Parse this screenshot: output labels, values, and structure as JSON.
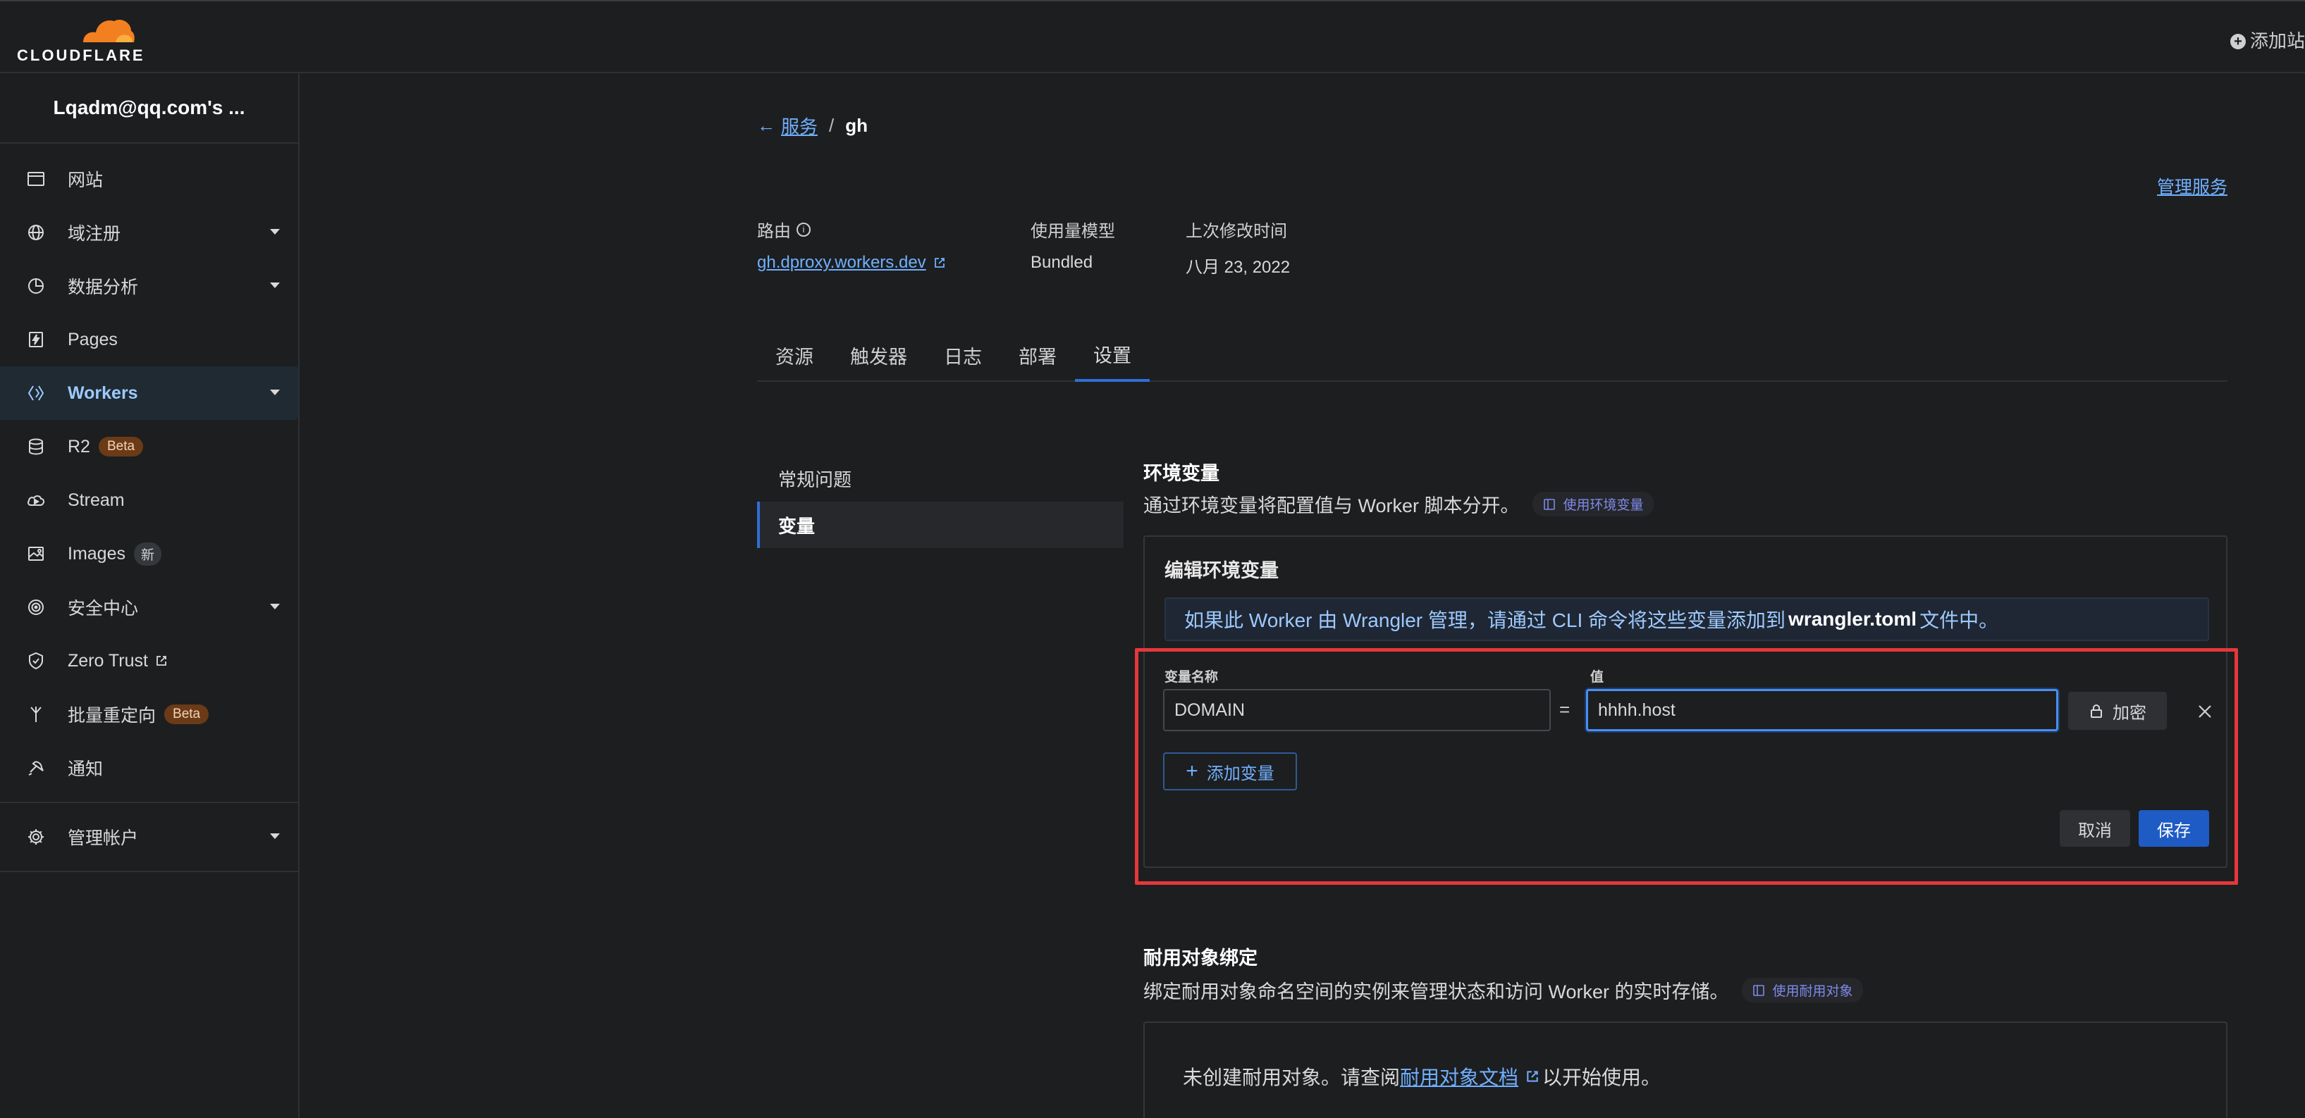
{
  "brand": {
    "name": "CLOUDFLARE",
    "orange": "#f38020"
  },
  "header": {
    "add_site_label": "添加站"
  },
  "sidebar": {
    "account": "Lqadm@qq.com's ...",
    "items": [
      {
        "label": "网站",
        "icon": "browser-window-icon"
      },
      {
        "label": "域注册",
        "icon": "globe-icon"
      },
      {
        "label": "数据分析",
        "icon": "pie-chart-icon"
      },
      {
        "label": "Pages",
        "icon": "lightning-page-icon"
      },
      {
        "label": "Workers",
        "icon": "workers-diamond-icon"
      },
      {
        "label": "R2",
        "icon": "database-icon",
        "badge": "Beta"
      },
      {
        "label": "Stream",
        "icon": "cloud-stream-icon"
      },
      {
        "label": "Images",
        "icon": "image-icon",
        "badge": "新"
      },
      {
        "label": "安全中心",
        "icon": "security-target-icon"
      },
      {
        "label": "Zero Trust",
        "icon": "shield-icon"
      },
      {
        "label": "批量重定向",
        "icon": "redirect-fork-icon",
        "badge": "Beta"
      },
      {
        "label": "通知",
        "icon": "notification-icon"
      },
      {
        "label": "管理帐户",
        "icon": "gear-icon"
      }
    ]
  },
  "breadcrumb": {
    "parent": "服务",
    "separator": "/",
    "current": "gh"
  },
  "manage_service": "管理服务",
  "meta": {
    "route_label": "路由",
    "route_value": "gh.dproxy.workers.dev",
    "usage_label": "使用量模型",
    "usage_value": "Bundled",
    "modified_label": "上次修改时间",
    "modified_value": "八月 23, 2022"
  },
  "tabs": [
    "资源",
    "触发器",
    "日志",
    "部署",
    "设置"
  ],
  "active_tab": "设置",
  "subnav": [
    "常规问题",
    "变量"
  ],
  "env": {
    "title": "环境变量",
    "desc": "通过环境变量将配置值与 Worker 脚本分开。",
    "doc_link": "使用环境变量",
    "edit_title": "编辑环境变量",
    "notice_pre": "如果此 Worker 由 Wrangler 管理，请通过 CLI 命令将这些变量添加到",
    "notice_file": "wrangler.toml",
    "notice_post": "文件中。",
    "name_label": "变量名称",
    "value_label": "值",
    "name_value": "DOMAIN",
    "value_value": "hhhh.host",
    "equals": "=",
    "encrypt_label": "加密",
    "add_var_label": "添加变量",
    "cancel_label": "取消",
    "save_label": "保存"
  },
  "durable": {
    "title": "耐用对象绑定",
    "desc": "绑定耐用对象命名空间的实例来管理状态和访问 Worker 的实时存储。",
    "doc_link": "使用耐用对象",
    "empty_pre": "未创建耐用对象。请查阅",
    "empty_link": "耐用对象文档",
    "empty_post": "以开始使用。"
  },
  "colors": {
    "accent": "#2f6fd6",
    "link": "#6fb0ff",
    "highlight": "#e5383b",
    "save": "#1f5bc4"
  }
}
